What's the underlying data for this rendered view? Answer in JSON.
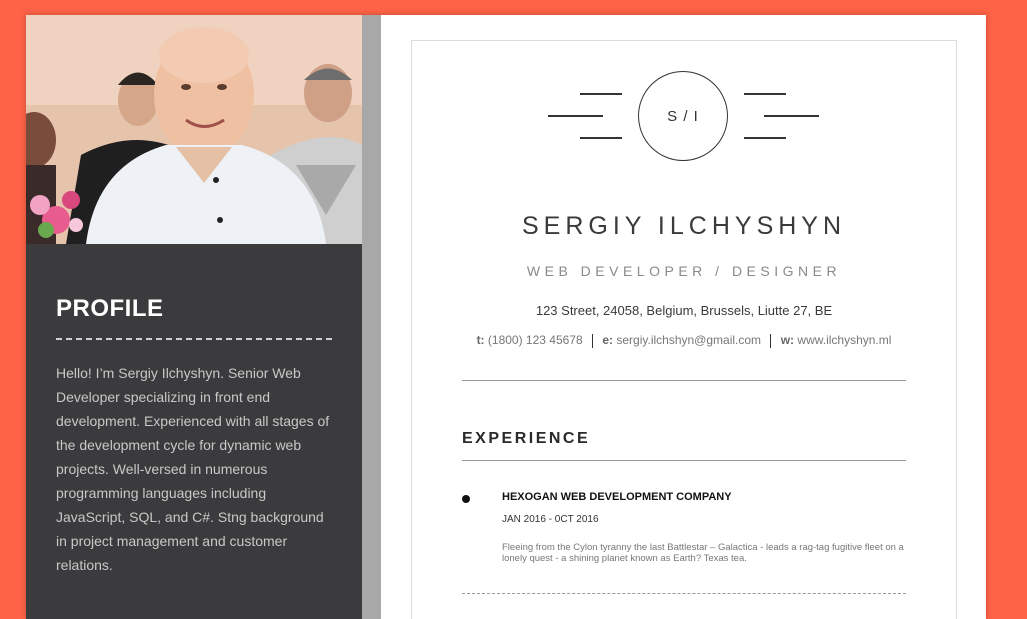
{
  "colors": {
    "page_bg": "#ff6347",
    "sidebar_bg": "#3b3b3d",
    "sidebar_text": "#c8c8c8",
    "accent_bar": "#a8a8a8"
  },
  "sidebar": {
    "profile_heading": "PROFILE",
    "profile_text": "Hello! I’m Sergiy Ilchyshyn. Senior Web Developer specializing in front end development. Experienced with all stages of the development cycle for dynamic web projects. Well-versed in numerous programming languages including JavaScript, SQL, and C#. Stng background in project management and customer relations."
  },
  "header": {
    "monogram": "S / I",
    "name": "SERGIY ILCHYSHYN",
    "role": "WEB DEVELOPER / DESIGNER",
    "address": "123 Street, 24058, Belgium, Brussels, Liutte 27, BE",
    "contacts": {
      "phone_label": "t:",
      "phone": "(1800) 123 45678",
      "email_label": "e:",
      "email": "sergiy.ilchshyn@gmail.com",
      "web_label": "w:",
      "web": "www.ilchyshyn.ml"
    }
  },
  "experience": {
    "heading": "EXPERIENCE",
    "jobs": [
      {
        "company": "HEXOGAN WEB DEVELOPMENT COMPANY",
        "dates": "JAN 2016 - 0CT 2016",
        "description": "Fleeing from the Cylon tyranny the last Battlestar – Galactica - leads a rag-tag fugitive fleet on a lonely quest - a shining planet known as Earth? Texas tea."
      }
    ]
  }
}
